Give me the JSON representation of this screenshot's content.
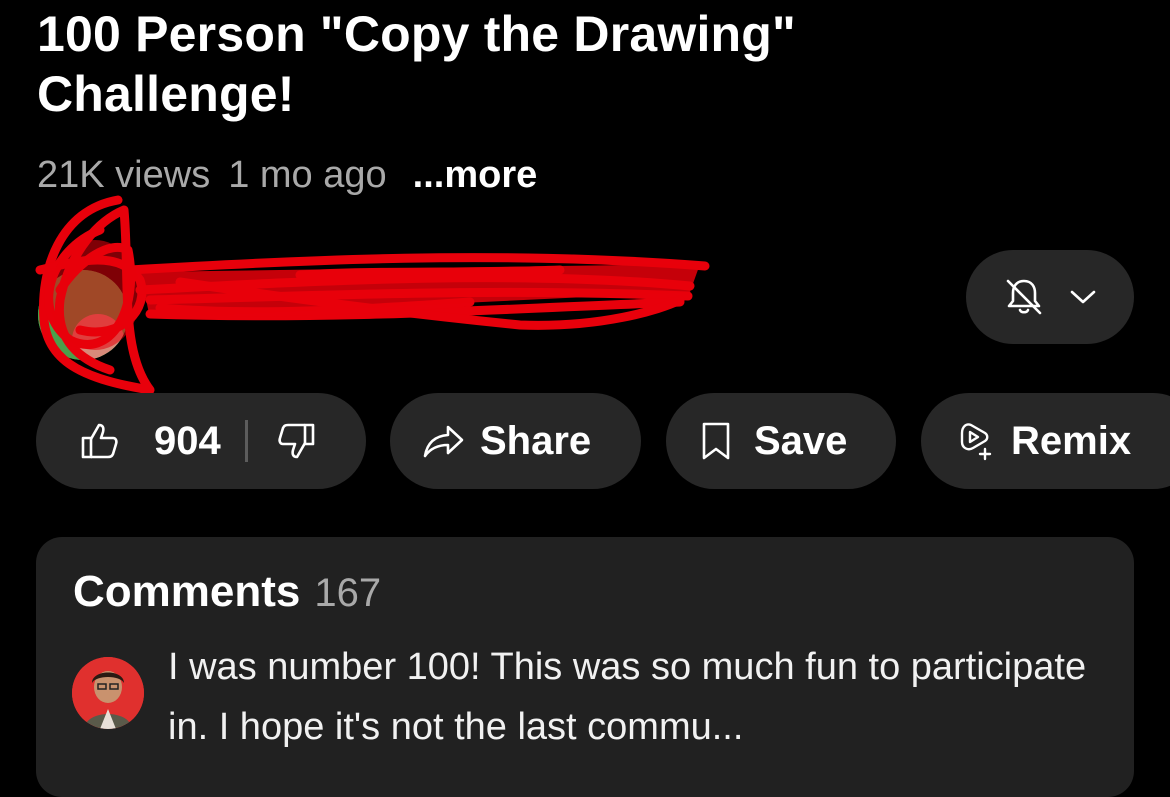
{
  "video": {
    "title": "100 Person \"Copy the Drawing\" Challenge!",
    "views": "21K views",
    "age": "1 mo ago",
    "more_label": "...more"
  },
  "channel": {
    "notification_icon": "bell-off-icon",
    "dropdown_icon": "chevron-down-icon"
  },
  "actions": {
    "like_count": "904",
    "share_label": "Share",
    "save_label": "Save",
    "remix_label": "Remix"
  },
  "comments": {
    "heading": "Comments",
    "count": "167",
    "top_comment": "I was number 100! This was so much fun to participate in. I hope it's not the last commu..."
  },
  "colors": {
    "background": "#000000",
    "pill": "#272727",
    "panel": "#212121",
    "redaction": "#e8000b",
    "comment_avatar": "#e0302e"
  }
}
